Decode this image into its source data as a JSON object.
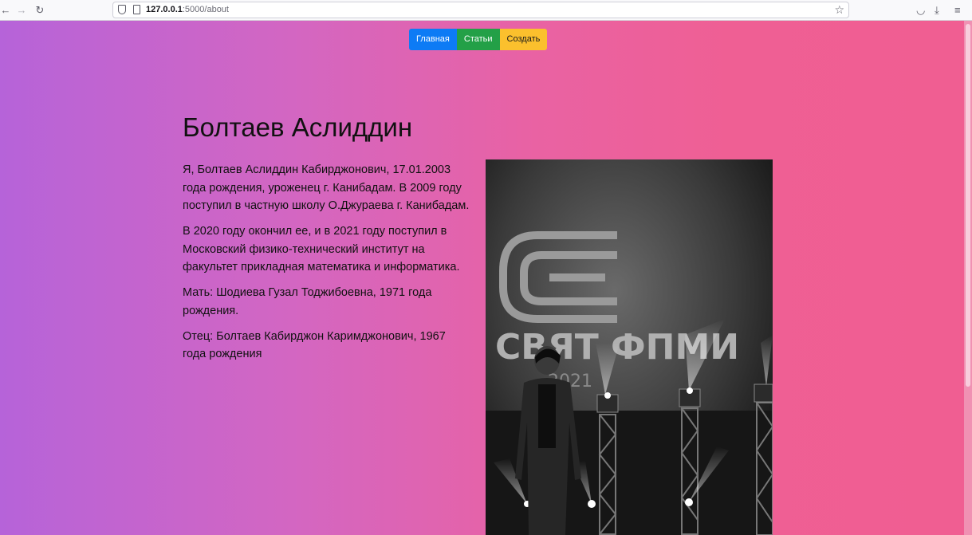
{
  "browser": {
    "url_host": "127.0.0.1",
    "url_path": ":5000/about"
  },
  "nav": {
    "home": "Главная",
    "articles": "Статьи",
    "create": "Создать"
  },
  "profile": {
    "name": "Болтаев Аслиддин",
    "paragraphs": [
      "Я, Болтаев Аслиддин Кабирджонович, 17.01.2003 года рождения, уроженец г. Канибадам. В 2009 году поступил в частную школу О.Джураева г. Канибадам.",
      "В 2020 году окончил ее, и в 2021 году поступил в Московский физико-технический институт на факультет прикладная математика и информатика.",
      "Мать: Шодиева Гузал Тоджибоевна, 1971 года рождения.",
      "Отец: Болтаев Кабирджон Каримджонович, 1967 года рождения"
    ]
  },
  "photo": {
    "banner_text": "СВЯТ ФПМИ",
    "year_text": "2021"
  },
  "colors": {
    "gradient_start": "#b663d9",
    "gradient_end": "#f05e92",
    "btn_home": "#0d7bf5",
    "btn_articles": "#23a047",
    "btn_create": "#fbc02d"
  }
}
